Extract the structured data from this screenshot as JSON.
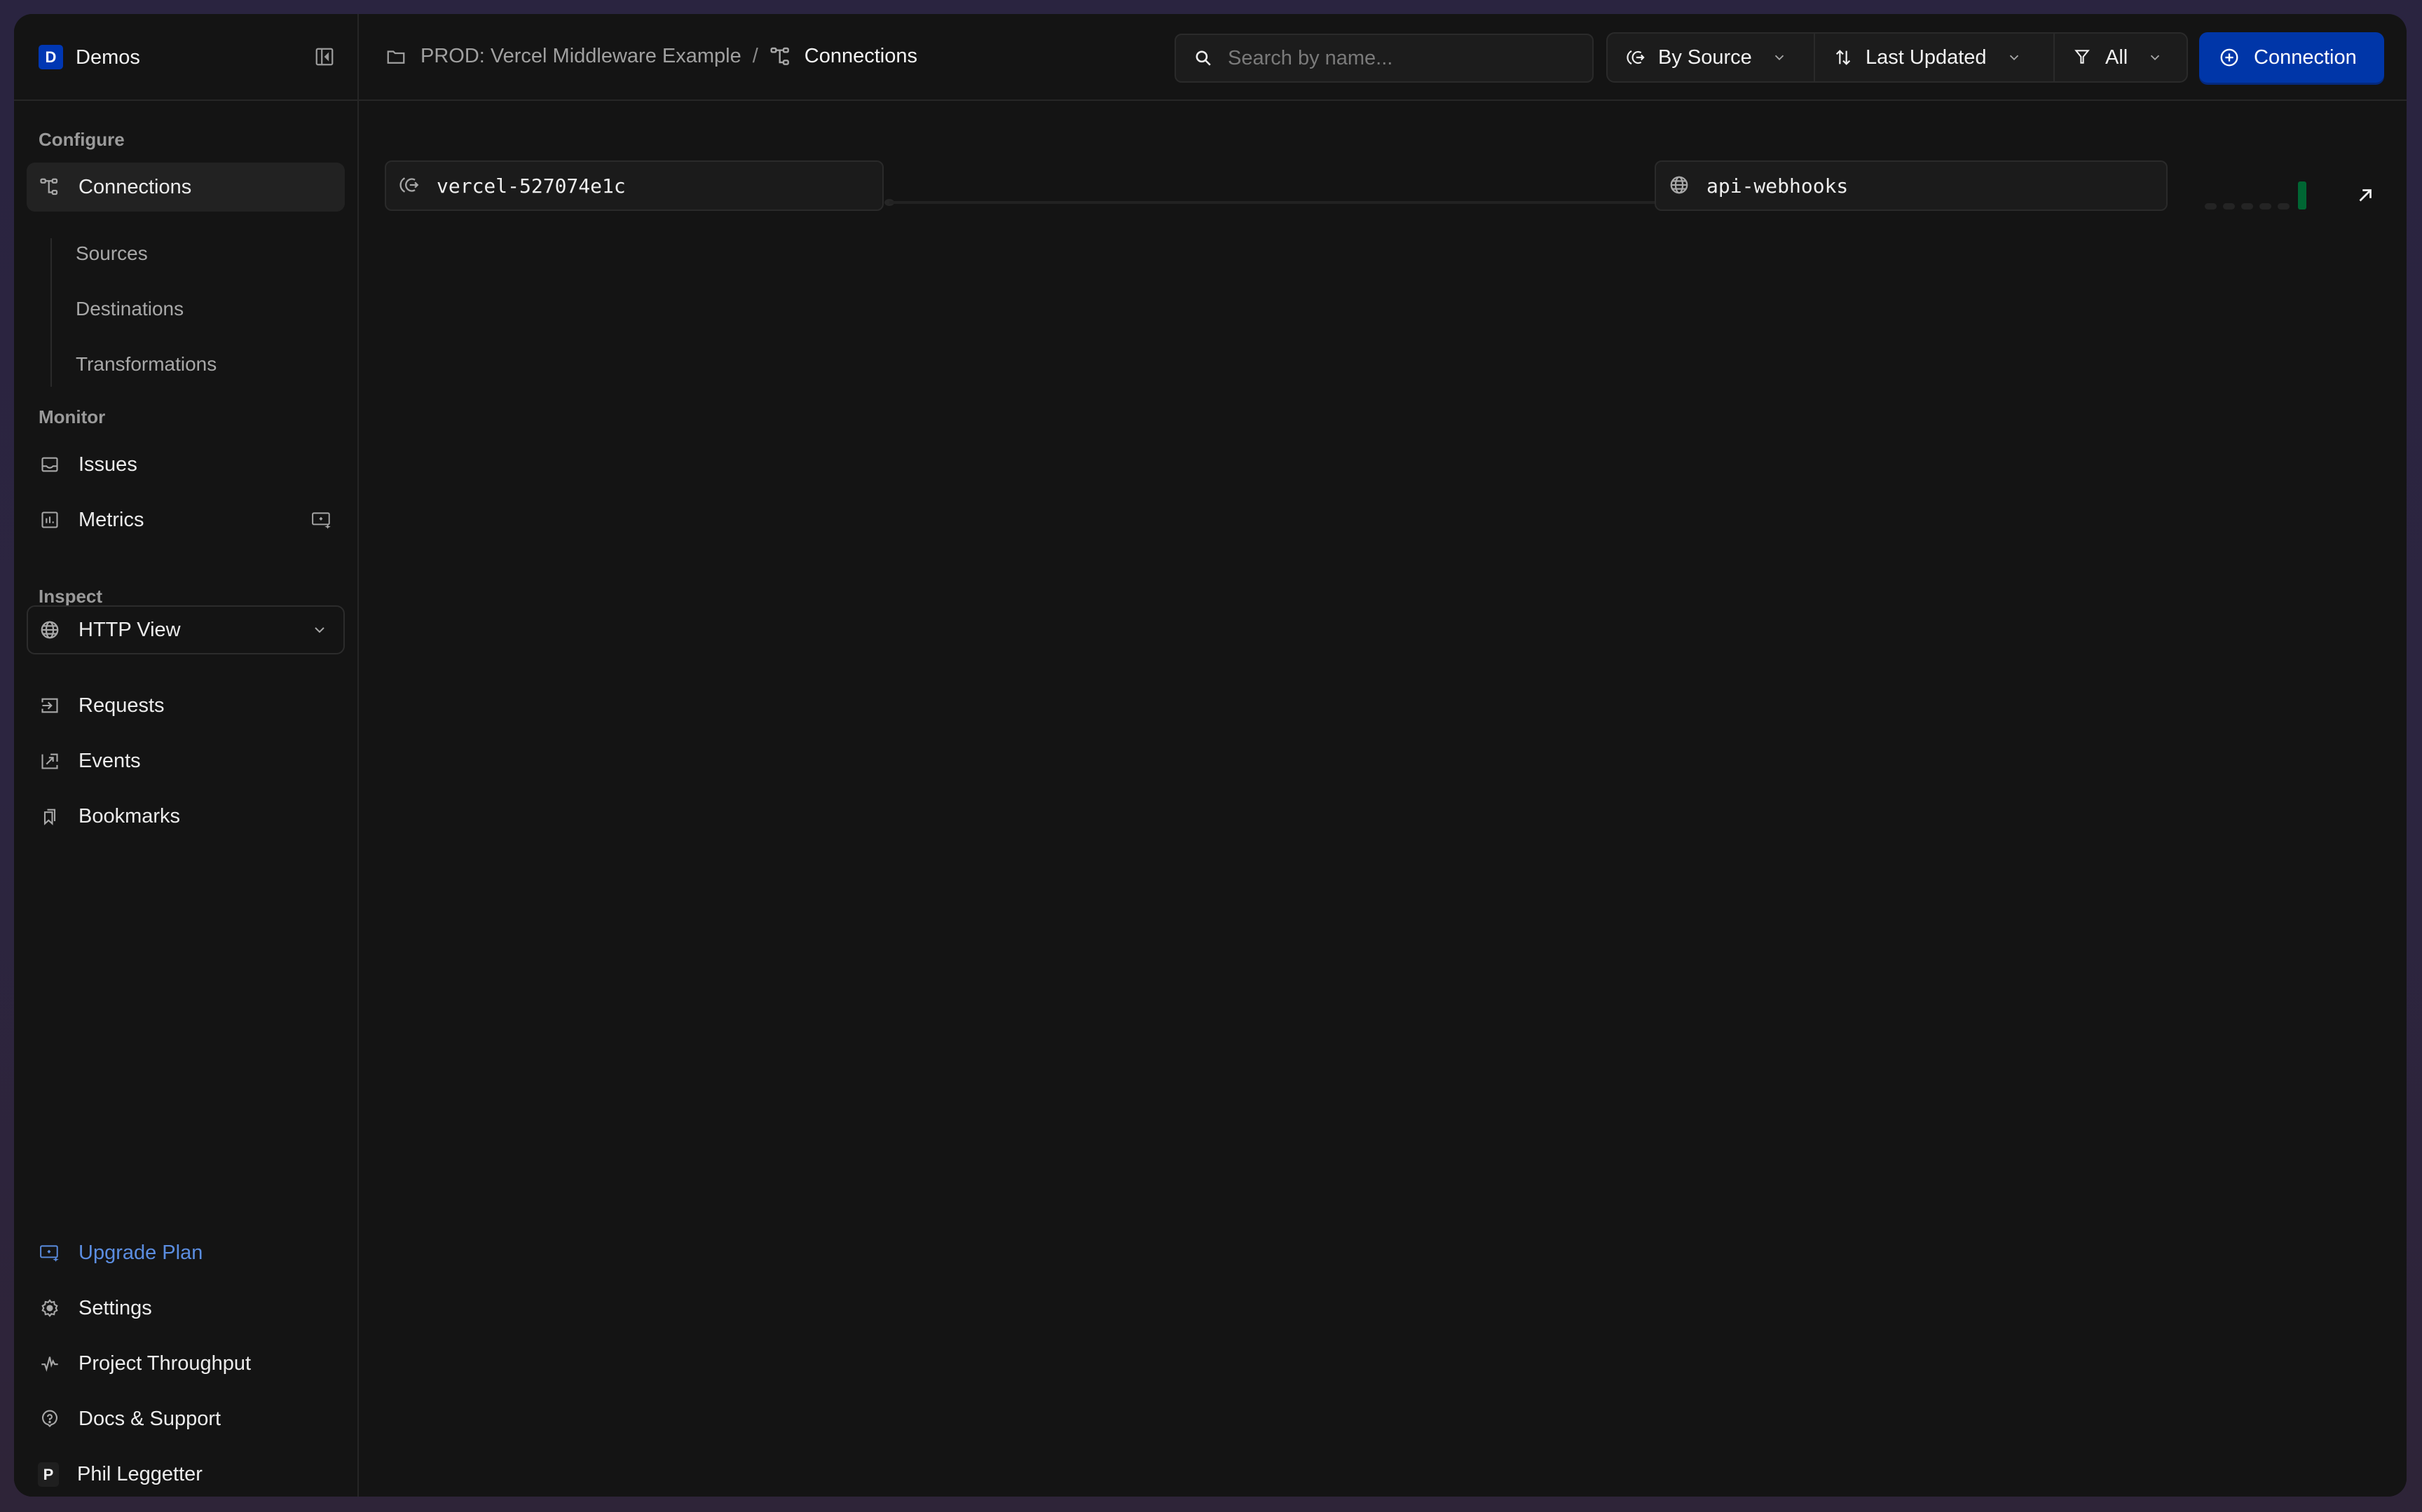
{
  "org": {
    "badge": "D",
    "name": "Demos",
    "badge_color": "#0037b3"
  },
  "sidebar": {
    "sections": {
      "configure": "Configure",
      "monitor": "Monitor",
      "inspect": "Inspect"
    },
    "configure_items": [
      {
        "label": "Connections",
        "icon": "connections-icon",
        "active": true
      }
    ],
    "configure_subitems": [
      "Sources",
      "Destinations",
      "Transformations"
    ],
    "monitor_items": [
      {
        "label": "Issues",
        "icon": "inbox-icon"
      },
      {
        "label": "Metrics",
        "icon": "bar-chart-icon",
        "badge_icon": "upgrade-sparkle-icon"
      }
    ],
    "inspect_view": {
      "label": "HTTP View",
      "icon": "globe-icon"
    },
    "inspect_items": [
      {
        "label": "Requests",
        "icon": "request-in-icon"
      },
      {
        "label": "Events",
        "icon": "event-out-icon"
      },
      {
        "label": "Bookmarks",
        "icon": "bookmarks-icon"
      }
    ],
    "bottom_items": [
      {
        "label": "Upgrade Plan",
        "icon": "upgrade-sparkle-icon",
        "color": "#5b8de0"
      },
      {
        "label": "Settings",
        "icon": "gear-icon"
      },
      {
        "label": "Project Throughput",
        "icon": "pulse-icon"
      },
      {
        "label": "Docs & Support",
        "icon": "help-icon"
      }
    ],
    "user": {
      "initial": "P",
      "name": "Phil Leggetter"
    }
  },
  "header": {
    "breadcrumb": {
      "project": "PROD: Vercel Middleware Example",
      "separator": "/",
      "current": "Connections"
    },
    "search": {
      "placeholder": "Search by name...",
      "value": ""
    },
    "group_by": {
      "label": "By Source"
    },
    "sort": {
      "label": "Last Updated"
    },
    "filter": {
      "label": "All"
    },
    "primary_button": {
      "label": "Connection",
      "color": "#0036a8"
    }
  },
  "connections": [
    {
      "source": {
        "name": "vercel-527074e1c",
        "icon": "source-icon"
      },
      "destination": {
        "name": "api-webhooks",
        "icon": "globe-icon"
      },
      "activity": {
        "bars": [
          0,
          0,
          0,
          0,
          0,
          1
        ],
        "active_color": "#006633"
      }
    }
  ]
}
